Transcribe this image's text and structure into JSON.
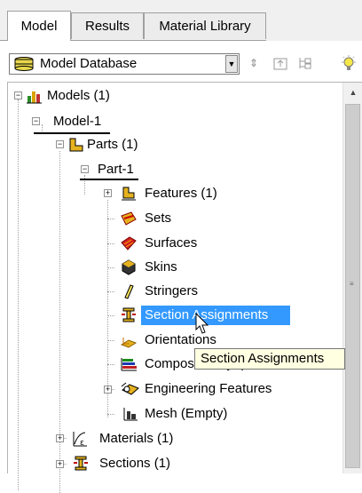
{
  "tabs": [
    {
      "label": "Model",
      "active": true
    },
    {
      "label": "Results",
      "active": false
    },
    {
      "label": "Material Library",
      "active": false
    }
  ],
  "toolbar": {
    "combo_value": "Model Database"
  },
  "tree": {
    "models": "Models (1)",
    "model1": "Model-1",
    "parts": "Parts (1)",
    "part1": "Part-1",
    "features": "Features (1)",
    "sets": "Sets",
    "surfaces": "Surfaces",
    "skins": "Skins",
    "stringers": "Stringers",
    "section_assignments": "Section Assignments",
    "orientations": "Orientations",
    "composite_layups": "Composite Layups",
    "engineering_features": "Engineering Features",
    "mesh": "Mesh (Empty)",
    "materials": "Materials (1)",
    "sections": "Sections (1)"
  },
  "tooltip": "Section Assignments",
  "colors": {
    "selection": "#3399ff",
    "tooltip_bg": "#ffffe1"
  }
}
